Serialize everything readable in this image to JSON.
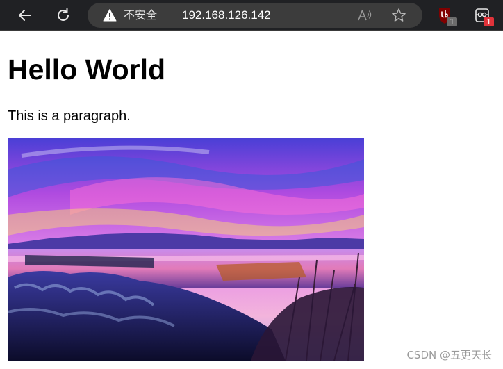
{
  "browser": {
    "security_label": "不安全",
    "url": "192.168.126.142",
    "extensions": [
      {
        "icon": "ublock-origin-icon",
        "badge": "1"
      },
      {
        "icon": "extension-icon",
        "badge": "1"
      }
    ],
    "colors": {
      "toolbar": "#202124",
      "address_bar": "#3c3c3c",
      "ublock": "#800000",
      "badge_red": "#e0333a"
    }
  },
  "page": {
    "heading": "Hello World",
    "paragraph": "This is a paragraph."
  },
  "watermark": "CSDN @五更天长"
}
